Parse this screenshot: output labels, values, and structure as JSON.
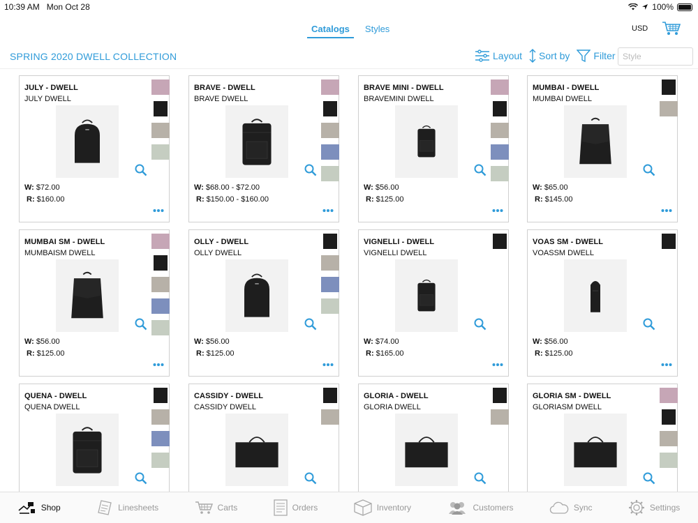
{
  "status": {
    "time": "10:39 AM",
    "date": "Mon Oct 28",
    "battery": "100%"
  },
  "segment": {
    "tabs": [
      "Catalogs",
      "Styles"
    ],
    "active": 0
  },
  "currency": "USD",
  "title": "SPRING 2020 DWELL COLLECTION",
  "toolbar": {
    "layout": "Layout",
    "sort": "Sort by",
    "filter": "Filter",
    "search_placeholder": "Style"
  },
  "colors": {
    "accent": "#2f9bd9",
    "mauve": "#c6a6b6",
    "black": "#1c1c1c",
    "taupe": "#b7b1a8",
    "blue": "#7d8fbd",
    "sage": "#c5cdc1"
  },
  "products": [
    {
      "name": "JULY - DWELL",
      "sub": "JULY DWELL",
      "w": "$72.00",
      "r": "$160.00",
      "swatches": [
        "mauve",
        "black",
        "taupe",
        "sage"
      ]
    },
    {
      "name": "BRAVE - DWELL",
      "sub": "BRAVE DWELL",
      "w": "$68.00 - $72.00",
      "r": "$150.00 - $160.00",
      "swatches": [
        "mauve",
        "black",
        "taupe",
        "blue",
        "sage"
      ]
    },
    {
      "name": "BRAVE MINI - DWELL",
      "sub": "BRAVEMINI DWELL",
      "w": "$56.00",
      "r": "$125.00",
      "swatches": [
        "mauve",
        "black",
        "taupe",
        "blue",
        "sage"
      ]
    },
    {
      "name": "MUMBAI - DWELL",
      "sub": "MUMBAI DWELL",
      "w": "$65.00",
      "r": "$145.00",
      "swatches": [
        "black",
        "taupe"
      ]
    },
    {
      "name": "MUMBAI SM - DWELL",
      "sub": "MUMBAISM DWELL",
      "w": "$56.00",
      "r": "$125.00",
      "swatches": [
        "mauve",
        "black",
        "taupe",
        "blue",
        "sage"
      ]
    },
    {
      "name": "OLLY - DWELL",
      "sub": "OLLY DWELL",
      "w": "$56.00",
      "r": "$125.00",
      "swatches": [
        "black",
        "taupe",
        "blue",
        "sage"
      ]
    },
    {
      "name": "VIGNELLI - DWELL",
      "sub": "VIGNELLI DWELL",
      "w": "$74.00",
      "r": "$165.00",
      "swatches": [
        "black"
      ]
    },
    {
      "name": "VOAS SM - DWELL",
      "sub": "VOASSM DWELL",
      "w": "$56.00",
      "r": "$125.00",
      "swatches": [
        "black"
      ]
    },
    {
      "name": "QUENA - DWELL",
      "sub": "QUENA DWELL",
      "w": "",
      "r": "",
      "swatches": [
        "black",
        "taupe",
        "blue",
        "sage"
      ]
    },
    {
      "name": "CASSIDY - DWELL",
      "sub": "CASSIDY DWELL",
      "w": "",
      "r": "",
      "swatches": [
        "black",
        "taupe"
      ]
    },
    {
      "name": "GLORIA - DWELL",
      "sub": "GLORIA DWELL",
      "w": "",
      "r": "",
      "swatches": [
        "black",
        "taupe"
      ]
    },
    {
      "name": "GLORIA SM - DWELL",
      "sub": "GLORIASM DWELL",
      "w": "",
      "r": "",
      "swatches": [
        "mauve",
        "black",
        "taupe",
        "sage"
      ]
    }
  ],
  "labels": {
    "wholesale": "W:",
    "retail": "R:"
  },
  "tabbar": [
    {
      "label": "Shop",
      "icon": "shop-icon",
      "active": true
    },
    {
      "label": "Linesheets",
      "icon": "linesheets-icon"
    },
    {
      "label": "Carts",
      "icon": "cart-icon"
    },
    {
      "label": "Orders",
      "icon": "orders-icon"
    },
    {
      "label": "Inventory",
      "icon": "inventory-icon"
    },
    {
      "label": "Customers",
      "icon": "customers-icon"
    },
    {
      "label": "Sync",
      "icon": "sync-icon"
    },
    {
      "label": "Settings",
      "icon": "settings-icon"
    }
  ]
}
